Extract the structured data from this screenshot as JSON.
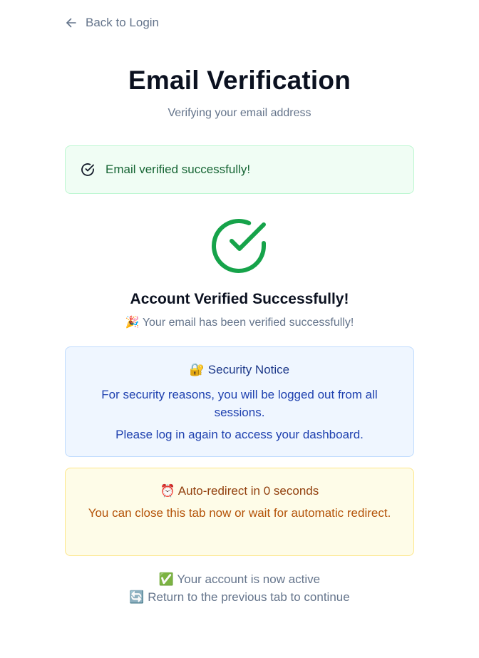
{
  "nav": {
    "back_label": "Back to Login"
  },
  "header": {
    "title": "Email Verification",
    "subtitle": "Verifying your email address"
  },
  "alert": {
    "message": "Email verified successfully!",
    "icon": "check-circle-icon"
  },
  "result": {
    "icon": "large-check-circle-icon",
    "title": "Account Verified Successfully!",
    "message_emoji": "🎉",
    "message": "Your email has been verified successfully!"
  },
  "security": {
    "emoji": "🔐",
    "title": "Security Notice",
    "text": "For security reasons, you will be logged out from all sessions.",
    "text2": "Please log in again to access your dashboard."
  },
  "redirect": {
    "emoji": "⏰",
    "title": "Auto-redirect in 0 seconds",
    "text": "You can close this tab now or wait for automatic redirect."
  },
  "footer": {
    "line1_emoji": "✅",
    "line1": "Your account is now active",
    "line2_emoji": "🔄",
    "line2": "Return to the previous tab to continue"
  },
  "colors": {
    "success_green": "#16a34a",
    "success_bg": "#f0fdf4",
    "info_bg": "#eff6ff",
    "warning_bg": "#fefce8",
    "title_text": "#0b1120",
    "muted_text": "#64748b"
  }
}
